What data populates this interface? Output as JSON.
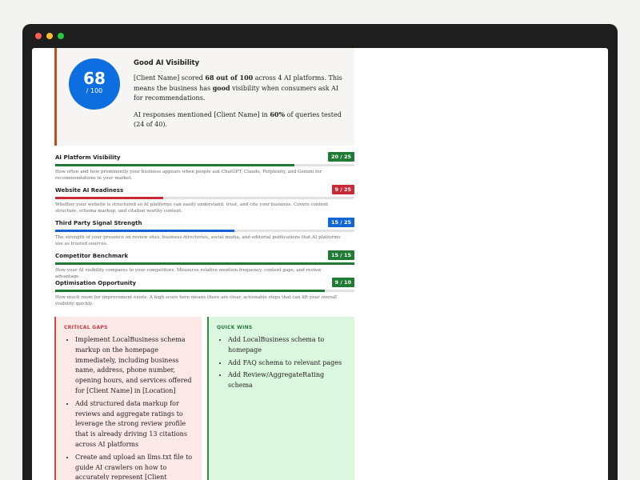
{
  "hero": {
    "score": "68",
    "score_denominator": "/ 100",
    "title": "Good AI Visibility",
    "para1_prefix": "[Client Name] scored ",
    "para1_score": "68 out of 100",
    "para1_mid": " across 4 AI platforms. This means the business has ",
    "para1_good": "good",
    "para1_suffix": " visibility when consumers ask AI for recommendations.",
    "para2_prefix": "AI responses mentioned [Client Name] in ",
    "para2_pct": "60%",
    "para2_suffix": " of queries tested (24 of 40)."
  },
  "metrics": [
    {
      "name": "AI Platform Visibility",
      "score_label": "20 / 25",
      "fraction": 0.8,
      "color": "#1f7a34",
      "description": "How often and how prominently your business appears when people ask ChatGPT, Claude, Perplexity, and Gemini for recommendations in your market."
    },
    {
      "name": "Website AI Readiness",
      "score_label": "9 / 25",
      "fraction": 0.36,
      "color": "#c82a36",
      "description": "Whether your website is structured so AI platforms can easily understand, trust, and cite your business. Covers content structure, schema markup, and citation worthy content."
    },
    {
      "name": "Third Party Signal Strength",
      "score_label": "15 / 25",
      "fraction": 0.6,
      "color": "#1266d4",
      "description": "The strength of your presence on review sites, business directories, social media, and editorial publications that AI platforms use as trusted sources."
    },
    {
      "name": "Competitor Benchmark",
      "score_label": "15 / 15",
      "fraction": 1.0,
      "color": "#1f7a34",
      "description": "How your AI visibility compares to your competitors. Measures relative mention frequency, content gaps, and review advantage."
    },
    {
      "name": "Optimisation Opportunity",
      "score_label": "9 / 10",
      "fraction": 0.9,
      "color": "#1f7a34",
      "description": "How much room for improvement exists. A high score here means there are clear, actionable steps that can lift your overall visibility quickly."
    }
  ],
  "critical_gaps": {
    "heading": "CRITICAL GAPS",
    "items": [
      "Implement LocalBusiness schema markup on the homepage immediately, including business name, address, phone number, opening hours, and services offered for [Client Name] in [Location]",
      "Add structured data markup for reviews and aggregate ratings to leverage the strong review profile that is already driving 13 citations across AI platforms",
      "Create and upload an llms.txt file to guide AI crawlers on how to accurately represent [Client Name]'s services, location, and key differentiators"
    ]
  },
  "quick_wins": {
    "heading": "QUICK WINS",
    "items": [
      "Add LocalBusiness schema to homepage",
      "Add FAQ schema to relevant pages",
      "Add Review/AggregateRating schema"
    ]
  }
}
